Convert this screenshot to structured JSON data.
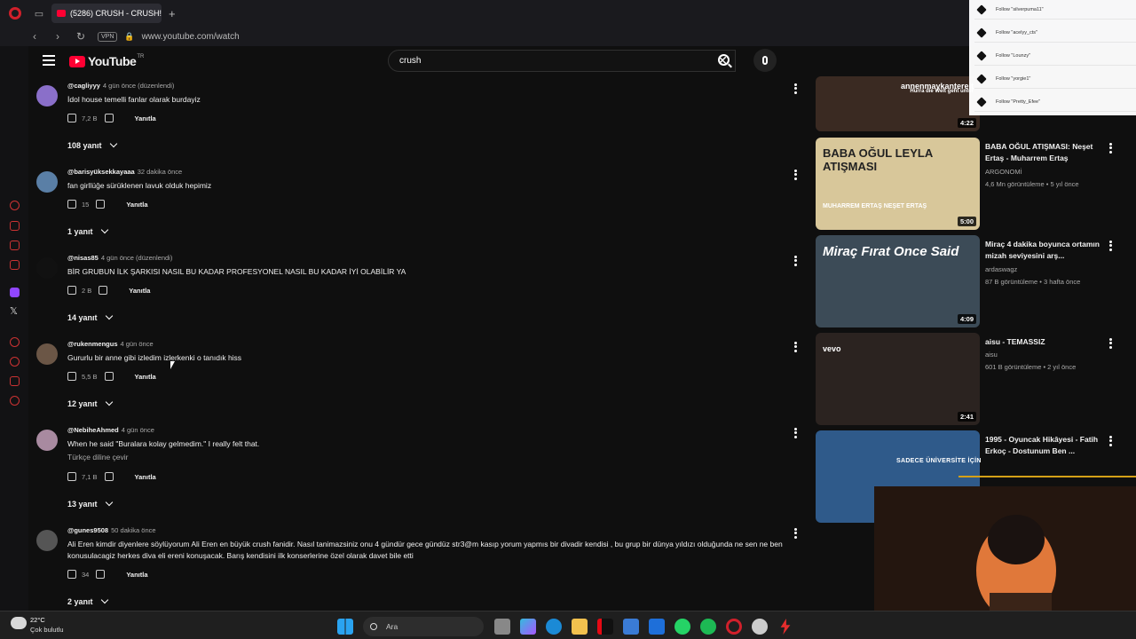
{
  "browser": {
    "tab_title": "(5286) CRUSH - CRUSH! |",
    "url": "www.youtube.com/watch",
    "vpn_label": "VPN"
  },
  "youtube": {
    "logo_text": "YouTube",
    "country_code": "TR",
    "search_value": "crush"
  },
  "comments": [
    {
      "user": "@cagliyyy",
      "time": "4 gün önce (düzenlendi)",
      "text": "İdol house temelli fanlar olarak burdayiz",
      "likes": "7,2 B",
      "reply_label": "Yanıtla",
      "replies": "108 yanıt",
      "avatar_color": "#8a6fc9"
    },
    {
      "user": "@barisyüksekkayaaa",
      "time": "32 dakika önce",
      "text": "fan girllüğe sürüklenen lavuk olduk hepimiz",
      "likes": "15",
      "reply_label": "Yanıtla",
      "replies": "1 yanıt",
      "avatar_color": "#5a7fa6"
    },
    {
      "user": "@nisas85",
      "time": "4 gün önce (düzenlendi)",
      "text": "BİR GRUBUN İLK ŞARKISI NASIL BU KADAR PROFESYONEL NASIL BU KADAR İYİ OLABİLİR YA",
      "likes": "2 B",
      "reply_label": "Yanıtla",
      "replies": "14 yanıt",
      "avatar_color": "#111111"
    },
    {
      "user": "@rukenmengus",
      "time": "4 gün önce",
      "text": "Gururlu bir anne gibi izledim izlerkenki o tanıdık hiss",
      "likes": "5,5 B",
      "reply_label": "Yanıtla",
      "replies": "12 yanıt",
      "avatar_color": "#6b5646"
    },
    {
      "user": "@NebiheAhmed",
      "time": "4 gün önce",
      "text": "When he said \"Buralara kolay gelmedim.\" I really felt that.",
      "translate": "Türkçe diline çevir",
      "likes": "7,1 B",
      "reply_label": "Yanıtla",
      "replies": "13 yanıt",
      "avatar_color": "#a88aa0"
    },
    {
      "user": "@gunes9508",
      "time": "50 dakika önce",
      "text": "Ali Eren kimdir diyenlere söylüyorum Ali Eren en büyük crush fanidir. Nasıl tanimazsiniz onu 4 gündür gece gündüz str3@m kasıp yorum yapmıs bir divadir kendisi , bu grup bir dünya yıldızı olduğunda ne sen ne ben konusulacagiz herkes diva eli ereni konuşacak. Barış kendisini ilk konserlerine özel olarak davet bile etti",
      "likes": "34",
      "reply_label": "Yanıtla",
      "replies": "2 yanıt",
      "avatar_color": "#555555"
    }
  ],
  "related": [
    {
      "title": "",
      "channel": "",
      "meta": "",
      "duration": "4:22",
      "thumb_caption": "annenmaykantereit",
      "thumb_subcaption": "Hurra die Welt geht unter",
      "thumb_color": "#3a2a22"
    },
    {
      "title": "BABA OĞUL ATIŞMASI: Neşet Ertaş - Muharrem Ertaş",
      "channel": "ARGONOMİ",
      "meta": "4,6 Mn görüntüleme • 5 yıl önce",
      "duration": "5:00",
      "thumb_caption": "BABA OĞUL LEYLA ATIŞMASI",
      "thumb_subcaption": "MUHARREM ERTAŞ  NEŞET ERTAŞ",
      "thumb_color": "#d8c79a"
    },
    {
      "title": "Miraç 4 dakika boyunca ortamın mizah seviyesini arş...",
      "channel": "ardaswagz",
      "meta": "87 B görüntüleme • 3 hafta önce",
      "duration": "4:09",
      "thumb_caption": "Miraç Fırat Once Said",
      "thumb_subcaption": "",
      "thumb_color": "#3c4b57"
    },
    {
      "title": "aisu - TEMASSIZ",
      "channel": "aisu",
      "meta": "601 B görüntüleme • 2 yıl önce",
      "duration": "2:41",
      "thumb_caption": "vevo",
      "thumb_subcaption": "",
      "thumb_color": "#2b2320"
    },
    {
      "title": "1995 - Oyuncak Hikâyesi - Fatih Erkoç - Dostunum Ben ...",
      "channel": "",
      "meta": "",
      "duration": "",
      "thumb_caption": "",
      "thumb_subcaption": "",
      "thumb_color": "#2f5a8a"
    }
  ],
  "follows": [
    "Follow \"silverpuma11\"",
    "Follow \"acelyy_cts\"",
    "Follow \"Lounzy\"",
    "Follow \"yorgie1\"",
    "Follow \"Pretty_Efee\""
  ],
  "overlay_text": "SADECE ÜNİVERSİTE İÇİN",
  "taskbar": {
    "temperature": "22°C",
    "weather": "Çok bulutlu",
    "search_placeholder": "Ara"
  }
}
